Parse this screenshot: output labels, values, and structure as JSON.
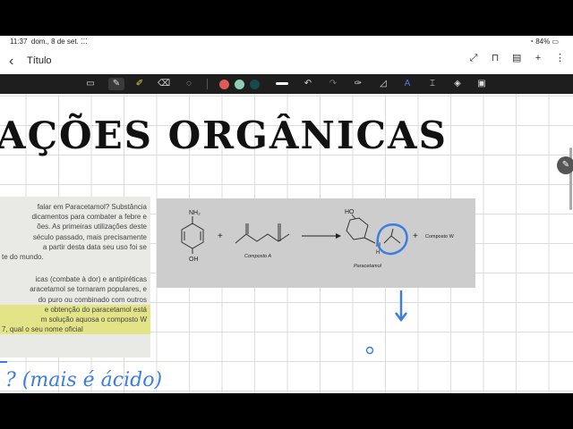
{
  "status": {
    "time": "11:37",
    "date": "dom., 8 de set.",
    "battery": "84%"
  },
  "header": {
    "title": "Título"
  },
  "heading": "AÇÕES ORGÂNICAS",
  "text_page": {
    "lines_p1": [
      "falar em Paracetamol? Substância",
      "dicamentos para combater a febre e",
      "ões. As primeiras utilizações deste",
      "século passado, mais precisamente",
      "a partir desta data seu uso foi se",
      "te do mundo."
    ],
    "lines_p2": [
      "icas (combate à dor) e antipiréticas",
      "aracetamol se tornaram populares, e",
      "do puro ou combinado com outros",
      "e obtenção do paracetamol está",
      "m solução aquosa o composto W",
      "7, qual o seu nome oficial"
    ]
  },
  "figure": {
    "label_nh2": "NH₂",
    "label_oh": "OH",
    "label_ho": "HO",
    "label_n": "N",
    "label_h": "H",
    "label_compostoA": "Composto A",
    "label_paracetamol": "Paracetamol",
    "label_compostoW": "Composto W",
    "plus": "+"
  },
  "handwriting": "? (mais é ácido)",
  "colors": {
    "toolbar_bg": "#1e1e1e",
    "accent_blue": "#3b7de0",
    "highlight": "#e2e487",
    "pen_red": "#e05a57",
    "pen_teal": "#8ecfb6",
    "pen_dark": "#174a4a"
  }
}
